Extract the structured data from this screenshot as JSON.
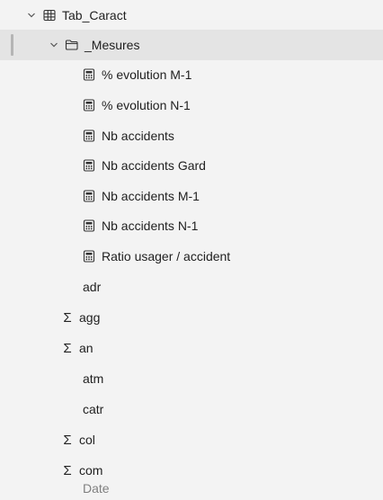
{
  "tree": {
    "table": {
      "label": "Tab_Caract",
      "icon": "table-icon"
    },
    "folder": {
      "label": "_Mesures",
      "icon": "folder-icon"
    },
    "measures": [
      {
        "label": "% evolution M-1",
        "icon": "calculator-icon"
      },
      {
        "label": "% evolution N-1",
        "icon": "calculator-icon"
      },
      {
        "label": "Nb accidents",
        "icon": "calculator-icon"
      },
      {
        "label": "Nb accidents Gard",
        "icon": "calculator-icon"
      },
      {
        "label": "Nb accidents M-1",
        "icon": "calculator-icon"
      },
      {
        "label": "Nb accidents N-1",
        "icon": "calculator-icon"
      },
      {
        "label": "Ratio usager / accident",
        "icon": "calculator-icon"
      }
    ],
    "columns": [
      {
        "label": "adr",
        "icon": ""
      },
      {
        "label": "agg",
        "icon": "sigma-icon"
      },
      {
        "label": "an",
        "icon": "sigma-icon"
      },
      {
        "label": "atm",
        "icon": ""
      },
      {
        "label": "catr",
        "icon": ""
      },
      {
        "label": "col",
        "icon": "sigma-icon"
      },
      {
        "label": "com",
        "icon": "sigma-icon"
      },
      {
        "label": "Date",
        "icon": ""
      }
    ]
  }
}
